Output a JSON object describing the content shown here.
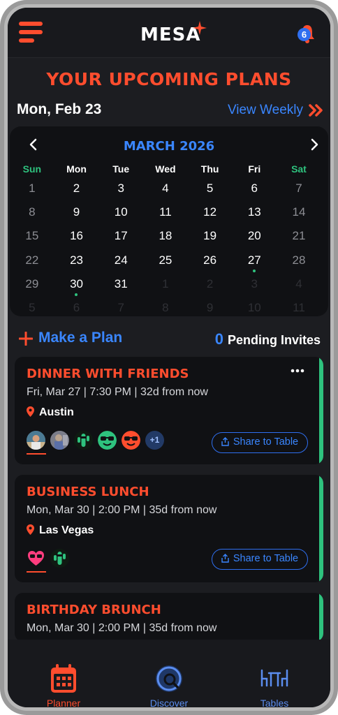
{
  "header": {
    "logo": "MESA",
    "notification_count": "6"
  },
  "heading": "YOUR UPCOMING PLANS",
  "date_row": {
    "current_date": "Mon, Feb 23",
    "view_weekly": "View Weekly"
  },
  "calendar": {
    "title": "MARCH 2026",
    "weekdays": [
      "Sun",
      "Mon",
      "Tue",
      "Wed",
      "Thu",
      "Fri",
      "Sat"
    ],
    "weeks": [
      [
        "1",
        "2",
        "3",
        "4",
        "5",
        "6",
        "7"
      ],
      [
        "8",
        "9",
        "10",
        "11",
        "12",
        "13",
        "14"
      ],
      [
        "15",
        "16",
        "17",
        "18",
        "19",
        "20",
        "21"
      ],
      [
        "22",
        "23",
        "24",
        "25",
        "26",
        "27",
        "28"
      ],
      [
        "29",
        "30",
        "31",
        "1",
        "2",
        "3",
        "4"
      ],
      [
        "5",
        "6",
        "7",
        "8",
        "9",
        "10",
        "11"
      ]
    ],
    "days_with_plans": [
      "27",
      "30"
    ]
  },
  "actions": {
    "make_plan": "Make a Plan",
    "pending_count": "0",
    "pending_label": "Pending Invites"
  },
  "plans": [
    {
      "title": "DINNER WITH FRIENDS",
      "meta": "Fri, Mar 27 | 7:30 PM | 32d from now",
      "location": "Austin",
      "extra_attendees": "+1",
      "share_label": "Share to Table",
      "accent": "#2ec27e"
    },
    {
      "title": "BUSINESS LUNCH",
      "meta": "Mon, Mar 30 | 2:00 PM | 35d from now",
      "location": "Las Vegas",
      "share_label": "Share to Table",
      "accent": "#2ec27e"
    },
    {
      "title": "BIRTHDAY BRUNCH",
      "meta": "Mon, Mar 30 | 2:00 PM | 35d from now",
      "accent": "#2ec27e"
    }
  ],
  "bottom_nav": [
    {
      "label": "Planner",
      "icon": "calendar-icon",
      "active": true
    },
    {
      "label": "Discover",
      "icon": "discover-icon",
      "active": false
    },
    {
      "label": "Tables",
      "icon": "tables-icon",
      "active": false
    }
  ],
  "colors": {
    "accent_orange": "#ff4d2e",
    "accent_blue": "#3a86ff",
    "accent_green": "#2ec27e",
    "background": "#1c1d21"
  }
}
